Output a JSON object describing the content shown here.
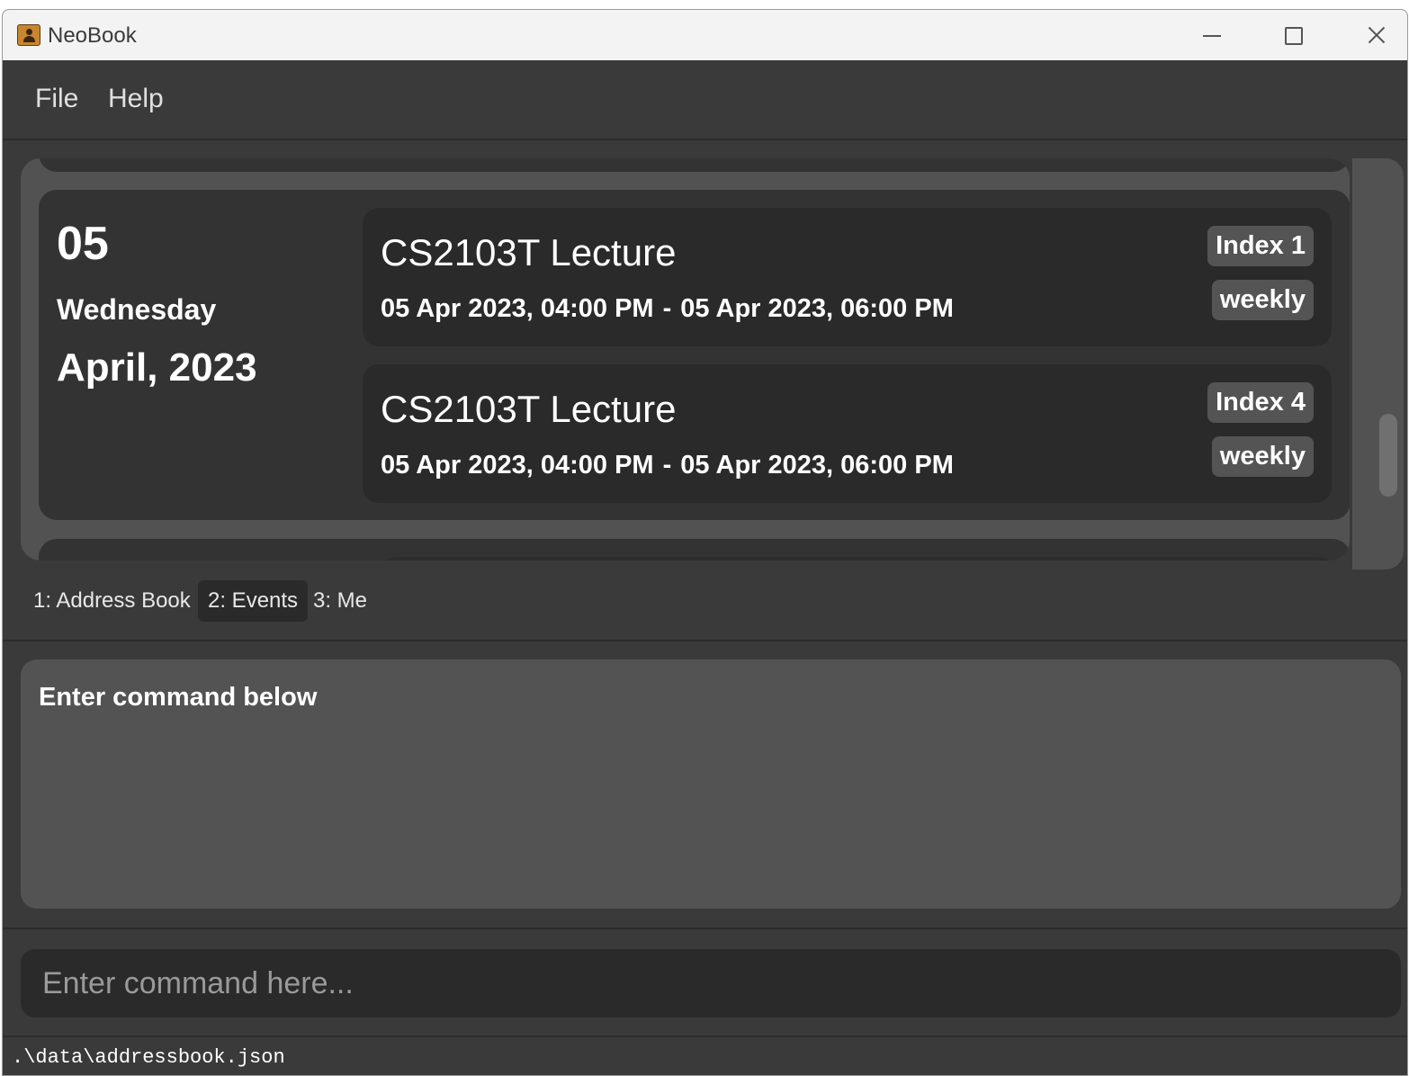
{
  "window": {
    "title": "NeoBook",
    "icon": "address-book-icon"
  },
  "menu": {
    "file": "File",
    "help": "Help"
  },
  "day": {
    "number": "05",
    "weekday": "Wednesday",
    "month_year": "April, 2023"
  },
  "events": [
    {
      "title": "CS2103T Lecture",
      "start": "05 Apr 2023, 04:00 PM",
      "separator": "-",
      "end": "05 Apr 2023, 06:00 PM",
      "index": "Index 1",
      "frequency": "weekly"
    },
    {
      "title": "CS2103T Lecture",
      "start": "05 Apr 2023, 04:00 PM",
      "separator": "-",
      "end": "05 Apr 2023, 06:00 PM",
      "index": "Index 4",
      "frequency": "weekly"
    }
  ],
  "tabs": [
    {
      "label": "1: Address Book",
      "active": false
    },
    {
      "label": "2: Events",
      "active": true
    },
    {
      "label": "3: Me",
      "active": false
    }
  ],
  "result": {
    "text": "Enter command below"
  },
  "command": {
    "value": "",
    "placeholder": "Enter command here..."
  },
  "status": {
    "path": ".\\data\\addressbook.json"
  },
  "colors": {
    "background": "#3a3a3a",
    "panel": "#525252",
    "card": "#333333",
    "event_card": "#2a2a2a",
    "badge": "#545454"
  }
}
